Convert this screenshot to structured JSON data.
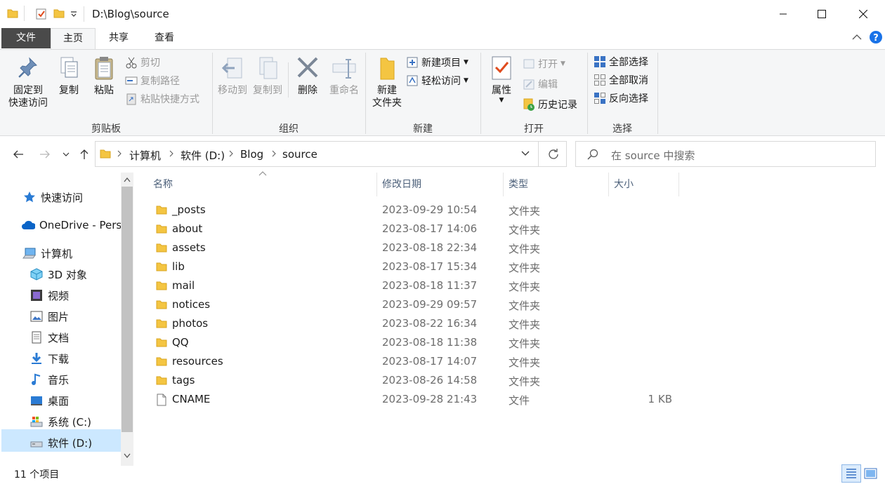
{
  "window": {
    "title": "D:\\Blog\\source"
  },
  "tabs": [
    {
      "label": "文件"
    },
    {
      "label": "主页"
    },
    {
      "label": "共享"
    },
    {
      "label": "查看"
    }
  ],
  "ribbon": {
    "clipboard": {
      "group": "剪贴板",
      "pin_line1": "固定到",
      "pin_line2": "快速访问",
      "copy": "复制",
      "paste": "粘贴",
      "cut": "剪切",
      "copy_path": "复制路径",
      "paste_shortcut": "粘贴快捷方式"
    },
    "organize": {
      "group": "组织",
      "move_to": "移动到",
      "copy_to": "复制到",
      "delete": "删除",
      "rename": "重命名"
    },
    "new": {
      "group": "新建",
      "new_folder_line1": "新建",
      "new_folder_line2": "文件夹",
      "new_item": "新建项目",
      "easy_access": "轻松访问"
    },
    "open": {
      "group": "打开",
      "properties": "属性",
      "open": "打开",
      "edit": "编辑",
      "history": "历史记录"
    },
    "select": {
      "group": "选择",
      "select_all": "全部选择",
      "select_none": "全部取消",
      "invert": "反向选择"
    }
  },
  "address": {
    "crumbs": [
      "计算机",
      "软件 (D:)",
      "Blog",
      "source"
    ]
  },
  "search": {
    "placeholder": "在 source 中搜索"
  },
  "nav": [
    {
      "label": "快速访问",
      "icon": "star-icon"
    },
    {
      "label": "OneDrive - Pers",
      "icon": "cloud-icon"
    },
    {
      "label": "计算机",
      "icon": "computer-icon"
    },
    {
      "label": "3D 对象",
      "icon": "cube-icon"
    },
    {
      "label": "视频",
      "icon": "video-icon"
    },
    {
      "label": "图片",
      "icon": "picture-icon"
    },
    {
      "label": "文档",
      "icon": "document-icon"
    },
    {
      "label": "下载",
      "icon": "download-icon"
    },
    {
      "label": "音乐",
      "icon": "music-icon"
    },
    {
      "label": "桌面",
      "icon": "desktop-icon"
    },
    {
      "label": "系统 (C:)",
      "icon": "drive-c-icon"
    },
    {
      "label": "软件 (D:)",
      "icon": "drive-d-icon"
    }
  ],
  "columns": {
    "name": "名称",
    "date": "修改日期",
    "type": "类型",
    "size": "大小"
  },
  "files": [
    {
      "name": "_posts",
      "date": "2023-09-29 10:54",
      "type": "文件夹",
      "size": "",
      "kind": "folder"
    },
    {
      "name": "about",
      "date": "2023-08-17 14:06",
      "type": "文件夹",
      "size": "",
      "kind": "folder"
    },
    {
      "name": "assets",
      "date": "2023-08-18 22:34",
      "type": "文件夹",
      "size": "",
      "kind": "folder"
    },
    {
      "name": "lib",
      "date": "2023-08-17 15:34",
      "type": "文件夹",
      "size": "",
      "kind": "folder"
    },
    {
      "name": "mail",
      "date": "2023-08-18 11:37",
      "type": "文件夹",
      "size": "",
      "kind": "folder"
    },
    {
      "name": "notices",
      "date": "2023-09-29 09:57",
      "type": "文件夹",
      "size": "",
      "kind": "folder"
    },
    {
      "name": "photos",
      "date": "2023-08-22 16:34",
      "type": "文件夹",
      "size": "",
      "kind": "folder"
    },
    {
      "name": "QQ",
      "date": "2023-08-18 11:38",
      "type": "文件夹",
      "size": "",
      "kind": "folder"
    },
    {
      "name": "resources",
      "date": "2023-08-17 14:07",
      "type": "文件夹",
      "size": "",
      "kind": "folder"
    },
    {
      "name": "tags",
      "date": "2023-08-26 14:58",
      "type": "文件夹",
      "size": "",
      "kind": "folder"
    },
    {
      "name": "CNAME",
      "date": "2023-09-28 21:43",
      "type": "文件",
      "size": "1 KB",
      "kind": "file"
    }
  ],
  "status": {
    "count": "11 个项目"
  },
  "colors": {
    "folder": "#f4c542",
    "accent": "#0078d7",
    "file_tab": "#4a4a4a"
  }
}
